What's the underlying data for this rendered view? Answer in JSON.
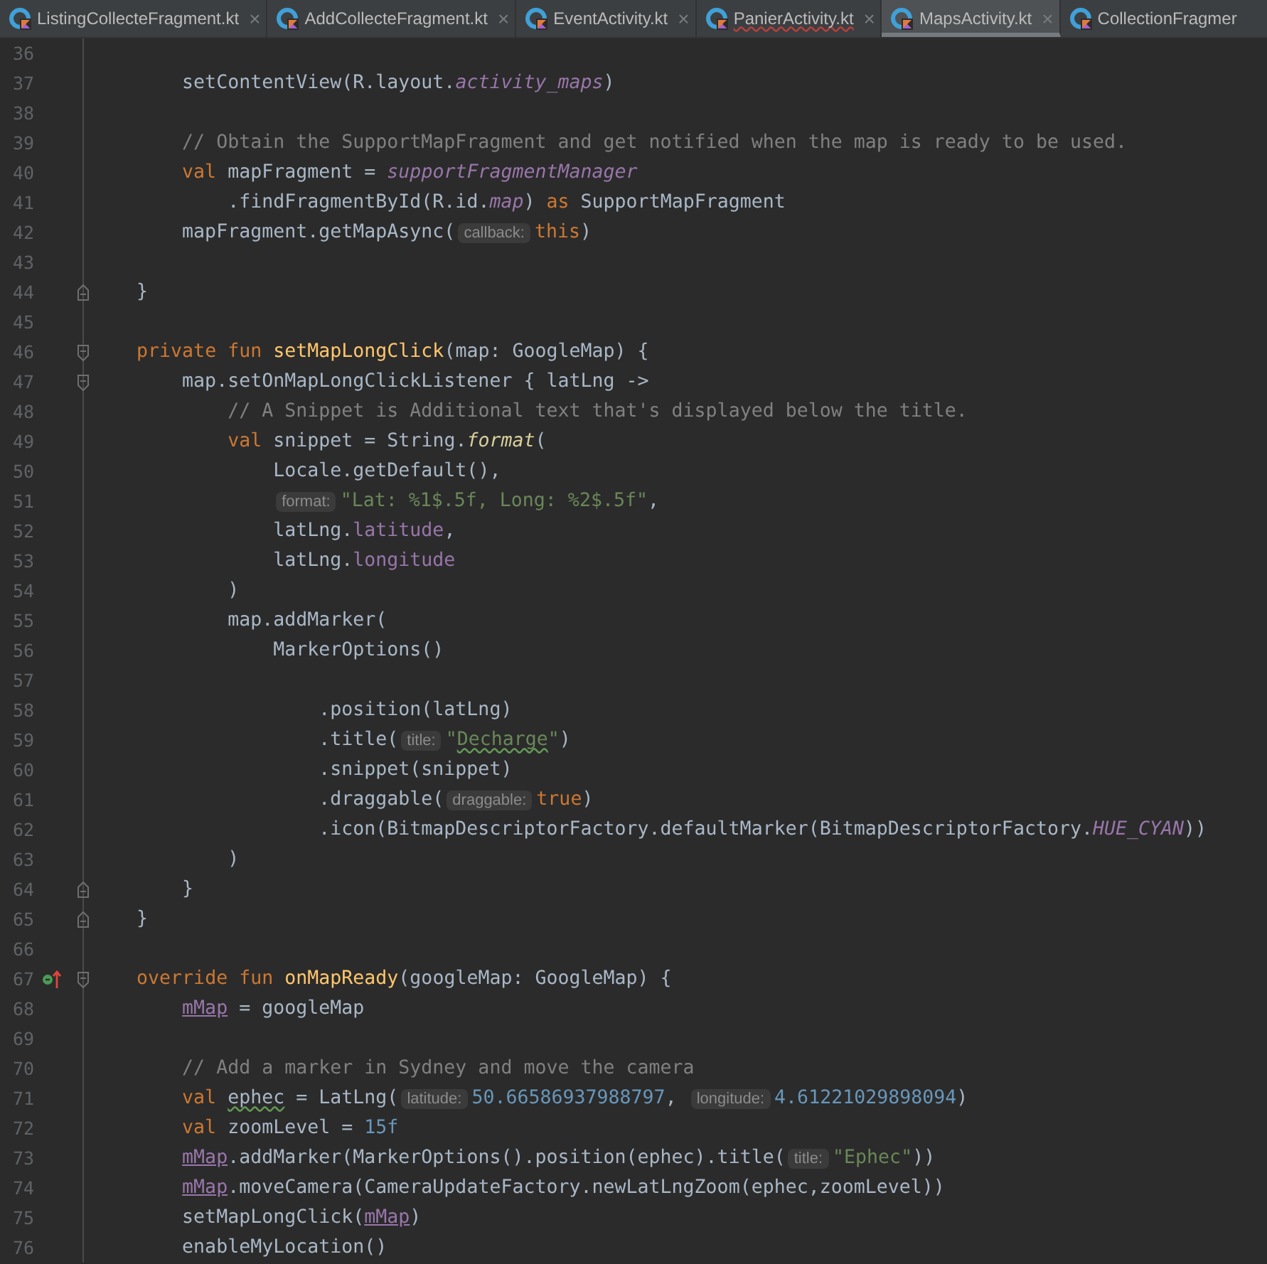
{
  "tabs": [
    {
      "label": "ListingCollecteFragment.kt",
      "selected": false,
      "typo": false,
      "closable": true
    },
    {
      "label": "AddCollecteFragment.kt",
      "selected": false,
      "typo": false,
      "closable": true
    },
    {
      "label": "EventActivity.kt",
      "selected": false,
      "typo": false,
      "closable": true
    },
    {
      "label": "PanierActivity.kt",
      "selected": false,
      "typo": true,
      "closable": true
    },
    {
      "label": "MapsActivity.kt",
      "selected": true,
      "typo": false,
      "closable": true
    },
    {
      "label": "CollectionFragmer",
      "selected": false,
      "typo": false,
      "closable": false
    }
  ],
  "close_glyph": "×",
  "lines": [
    {
      "number": "36"
    },
    {
      "number": "37",
      "tokens": [
        {
          "kind": "plain",
          "text": "        setContentView(R.layout."
        },
        {
          "kind": "field",
          "text": "activity_maps"
        },
        {
          "kind": "plain",
          "text": ")"
        }
      ]
    },
    {
      "number": "38"
    },
    {
      "number": "39",
      "tokens": [
        {
          "kind": "comment",
          "text": "        // Obtain the SupportMapFragment and get notified when the map is ready to be used."
        }
      ]
    },
    {
      "number": "40",
      "tokens": [
        {
          "kind": "keyword",
          "text": "        val"
        },
        {
          "kind": "plain",
          "text": " mapFragment = "
        },
        {
          "kind": "field",
          "text": "supportFragmentManager"
        }
      ]
    },
    {
      "number": "41",
      "tokens": [
        {
          "kind": "plain",
          "text": "            .findFragmentById(R.id."
        },
        {
          "kind": "field",
          "text": "map"
        },
        {
          "kind": "plain",
          "text": ") "
        },
        {
          "kind": "keyword",
          "text": "as"
        },
        {
          "kind": "plain",
          "text": " SupportMapFragment"
        }
      ]
    },
    {
      "number": "42",
      "tokens": [
        {
          "kind": "plain",
          "text": "        mapFragment.getMapAsync("
        },
        {
          "kind": "hint",
          "text": "callback:"
        },
        {
          "kind": "keyword",
          "text": "this"
        },
        {
          "kind": "plain",
          "text": ")"
        }
      ]
    },
    {
      "number": "43"
    },
    {
      "number": "44",
      "fold_end": true,
      "tokens": [
        {
          "kind": "plain",
          "text": "    }"
        }
      ]
    },
    {
      "number": "45"
    },
    {
      "number": "46",
      "fold_start": true,
      "tokens": [
        {
          "kind": "keyword",
          "text": "    private fun "
        },
        {
          "kind": "function",
          "text": "setMapLongClick"
        },
        {
          "kind": "plain",
          "text": "(map: GoogleMap) {"
        }
      ]
    },
    {
      "number": "47",
      "fold_start": true,
      "tokens": [
        {
          "kind": "plain",
          "text": "        map.setOnMapLongClickListener { latLng ->"
        }
      ]
    },
    {
      "number": "48",
      "tokens": [
        {
          "kind": "comment",
          "text": "            // A Snippet is Additional text that's displayed below the title."
        }
      ]
    },
    {
      "number": "49",
      "tokens": [
        {
          "kind": "keyword",
          "text": "            val"
        },
        {
          "kind": "plain",
          "text": " snippet = String."
        },
        {
          "kind": "static",
          "text": "format"
        },
        {
          "kind": "plain",
          "text": "("
        }
      ]
    },
    {
      "number": "50",
      "tokens": [
        {
          "kind": "plain",
          "text": "                Locale.getDefault(),"
        }
      ]
    },
    {
      "number": "51",
      "tokens": [
        {
          "kind": "hint",
          "text": "                format:"
        },
        {
          "kind": "string",
          "text": "\"Lat: %1$.5f, Long: %2$.5f\""
        },
        {
          "kind": "plain",
          "text": ","
        }
      ]
    },
    {
      "number": "52",
      "tokens": [
        {
          "kind": "plain",
          "text": "                latLng."
        },
        {
          "kind": "property",
          "text": "latitude"
        },
        {
          "kind": "plain",
          "text": ","
        }
      ]
    },
    {
      "number": "53",
      "tokens": [
        {
          "kind": "plain",
          "text": "                latLng."
        },
        {
          "kind": "property",
          "text": "longitude"
        }
      ]
    },
    {
      "number": "54",
      "tokens": [
        {
          "kind": "plain",
          "text": "            )"
        }
      ]
    },
    {
      "number": "55",
      "tokens": [
        {
          "kind": "plain",
          "text": "            map.addMarker("
        }
      ]
    },
    {
      "number": "56",
      "tokens": [
        {
          "kind": "plain",
          "text": "                MarkerOptions()"
        }
      ]
    },
    {
      "number": "57"
    },
    {
      "number": "58",
      "tokens": [
        {
          "kind": "plain",
          "text": "                    .position(latLng)"
        }
      ]
    },
    {
      "number": "59",
      "tokens": [
        {
          "kind": "plain",
          "text": "                    .title("
        },
        {
          "kind": "hint",
          "text": "title:"
        },
        {
          "kind": "string",
          "text": "\""
        },
        {
          "kind": "string",
          "text": "Decharge",
          "typo": true
        },
        {
          "kind": "string",
          "text": "\""
        },
        {
          "kind": "plain",
          "text": ")"
        }
      ]
    },
    {
      "number": "60",
      "tokens": [
        {
          "kind": "plain",
          "text": "                    .snippet(snippet)"
        }
      ]
    },
    {
      "number": "61",
      "tokens": [
        {
          "kind": "plain",
          "text": "                    .draggable("
        },
        {
          "kind": "hint",
          "text": "draggable:"
        },
        {
          "kind": "keyword",
          "text": "true"
        },
        {
          "kind": "plain",
          "text": ")"
        }
      ]
    },
    {
      "number": "62",
      "tokens": [
        {
          "kind": "plain",
          "text": "                    .icon(BitmapDescriptorFactory.defaultMarker(BitmapDescriptorFactory."
        },
        {
          "kind": "constant",
          "text": "HUE_CYAN"
        },
        {
          "kind": "plain",
          "text": "))"
        }
      ]
    },
    {
      "number": "63",
      "tokens": [
        {
          "kind": "plain",
          "text": "            )"
        }
      ]
    },
    {
      "number": "64",
      "fold_end": true,
      "tokens": [
        {
          "kind": "plain",
          "text": "        }"
        }
      ]
    },
    {
      "number": "65",
      "fold_end": true,
      "tokens": [
        {
          "kind": "plain",
          "text": "    }"
        }
      ]
    },
    {
      "number": "66"
    },
    {
      "number": "67",
      "fold_start": true,
      "overrides": true,
      "tokens": [
        {
          "kind": "keyword",
          "text": "    override fun "
        },
        {
          "kind": "function",
          "text": "onMapReady"
        },
        {
          "kind": "plain",
          "text": "(googleMap: GoogleMap) {"
        }
      ]
    },
    {
      "number": "68",
      "tokens": [
        {
          "kind": "member",
          "text": "        mMap"
        },
        {
          "kind": "plain",
          "text": " = googleMap"
        }
      ]
    },
    {
      "number": "69"
    },
    {
      "number": "70",
      "tokens": [
        {
          "kind": "comment",
          "text": "        // Add a marker in Sydney and move the camera"
        }
      ]
    },
    {
      "number": "71",
      "tokens": [
        {
          "kind": "keyword",
          "text": "        val "
        },
        {
          "kind": "plain",
          "text": "ephec",
          "typo": true
        },
        {
          "kind": "plain",
          "text": " = LatLng("
        },
        {
          "kind": "hint",
          "text": "latitude:"
        },
        {
          "kind": "number",
          "text": "50.66586937988797"
        },
        {
          "kind": "plain",
          "text": ", "
        },
        {
          "kind": "hint",
          "text": "longitude:"
        },
        {
          "kind": "number",
          "text": "4.61221029898094"
        },
        {
          "kind": "plain",
          "text": ")"
        }
      ]
    },
    {
      "number": "72",
      "tokens": [
        {
          "kind": "keyword",
          "text": "        val"
        },
        {
          "kind": "plain",
          "text": " zoomLevel = "
        },
        {
          "kind": "number",
          "text": "15f"
        }
      ]
    },
    {
      "number": "73",
      "tokens": [
        {
          "kind": "member",
          "text": "        mMap"
        },
        {
          "kind": "plain",
          "text": ".addMarker(MarkerOptions().position(ephec).title("
        },
        {
          "kind": "hint",
          "text": "title:"
        },
        {
          "kind": "string",
          "text": "\"Ephec\""
        },
        {
          "kind": "plain",
          "text": "))"
        }
      ]
    },
    {
      "number": "74",
      "tokens": [
        {
          "kind": "member",
          "text": "        mMap"
        },
        {
          "kind": "plain",
          "text": ".moveCamera(CameraUpdateFactory.newLatLngZoom(ephec,zoomLevel))"
        }
      ]
    },
    {
      "number": "75",
      "tokens": [
        {
          "kind": "plain",
          "text": "        setMapLongClick("
        },
        {
          "kind": "member",
          "text": "mMap"
        },
        {
          "kind": "plain",
          "text": ")"
        }
      ]
    },
    {
      "number": "76",
      "tokens": [
        {
          "kind": "plain",
          "text": "        enableMyLocation()"
        }
      ]
    }
  ]
}
